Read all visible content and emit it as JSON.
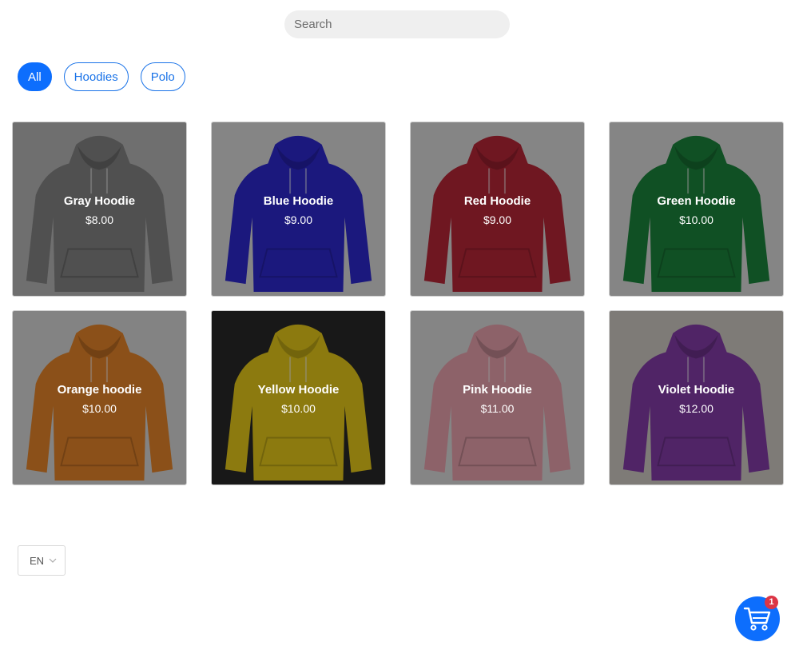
{
  "search": {
    "placeholder": "Search",
    "value": ""
  },
  "filters": [
    {
      "label": "All",
      "active": true
    },
    {
      "label": "Hoodies",
      "active": false
    },
    {
      "label": "Polo",
      "active": false
    }
  ],
  "products": [
    {
      "name": "Gray Hoodie",
      "price": "$8.00",
      "color": "#8a8a8a",
      "bg": "#bfbfbf"
    },
    {
      "name": "Blue Hoodie",
      "price": "$9.00",
      "color": "#2f2ad8",
      "bg": "#e6e6e6"
    },
    {
      "name": "Red Hoodie",
      "price": "$9.00",
      "color": "#c0283a",
      "bg": "#e6e6e6"
    },
    {
      "name": "Green Hoodie",
      "price": "$10.00",
      "color": "#1d8a3e",
      "bg": "#e6e6e6"
    },
    {
      "name": "Orange hoodie",
      "price": "$10.00",
      "color": "#f08a2c",
      "bg": "#e2e2e2"
    },
    {
      "name": "Yellow Hoodie",
      "price": "$10.00",
      "color": "#f1d21a",
      "bg": "#2a2a2a"
    },
    {
      "name": "Pink Hoodie",
      "price": "$11.00",
      "color": "#f3a9b6",
      "bg": "#e6e6e6"
    },
    {
      "name": "Violet Hoodie",
      "price": "$12.00",
      "color": "#8a3fb0",
      "bg": "#d9d4ce"
    }
  ],
  "language": {
    "selected": "EN",
    "icon": "chevron-down-icon"
  },
  "cart": {
    "count": "1",
    "icon": "cart-icon"
  },
  "colors": {
    "accent": "#0d6efd",
    "badge": "#dc3545"
  }
}
